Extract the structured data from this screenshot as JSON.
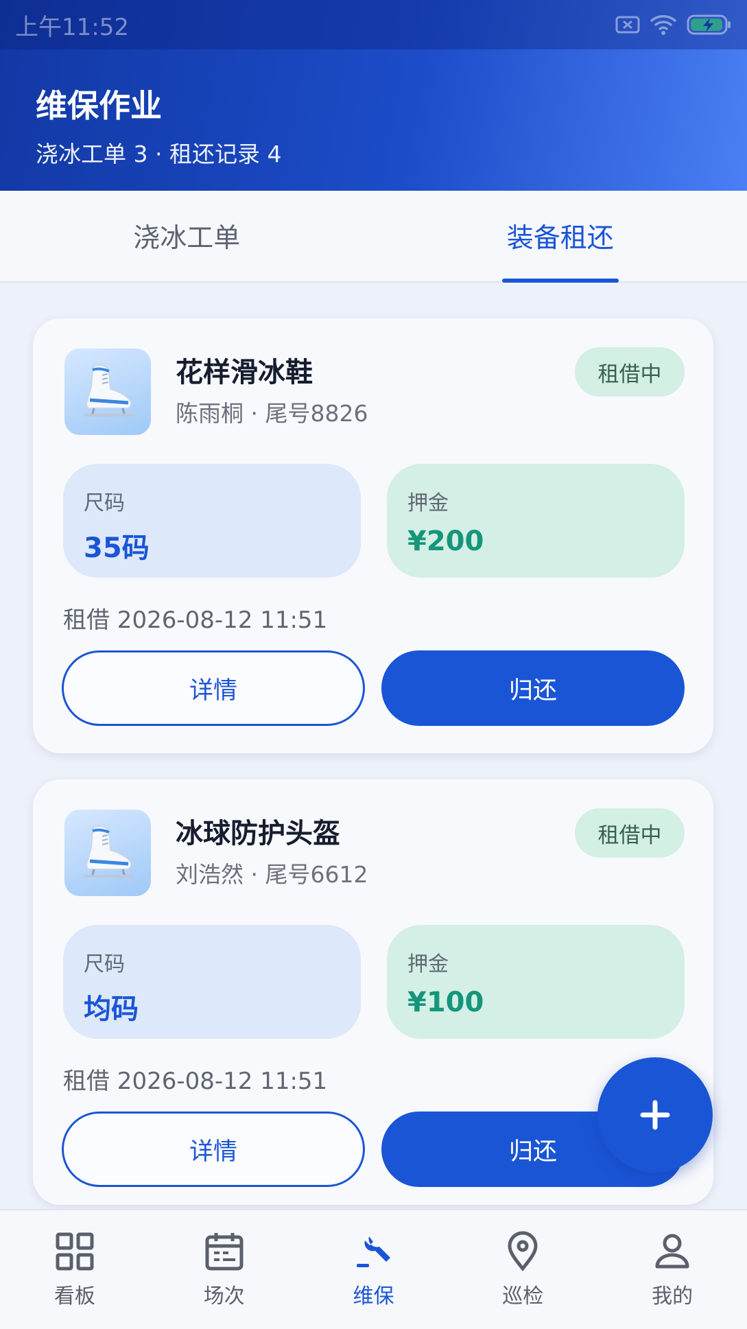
{
  "status_bar": {
    "time": "上午11:52"
  },
  "header": {
    "title": "维保作业",
    "subtitle": "浇冰工单 3 · 租还记录 4"
  },
  "tabs": [
    {
      "label": "浇冰工单",
      "active": false
    },
    {
      "label": "装备租还",
      "active": true
    }
  ],
  "rentals": [
    {
      "icon": "ice-skate-icon",
      "name": "花样滑冰鞋",
      "renter": "陈雨桐 · 尾号8826",
      "status": "租借中",
      "size_label": "尺码",
      "size_value": "35码",
      "deposit_label": "押金",
      "deposit_value": "¥200",
      "rent_time": "租借 2026-08-12 11:51",
      "detail_label": "详情",
      "return_label": "归还"
    },
    {
      "icon": "ice-skate-icon",
      "name": "冰球防护头盔",
      "renter": "刘浩然 · 尾号6612",
      "status": "租借中",
      "size_label": "尺码",
      "size_value": "均码",
      "deposit_label": "押金",
      "deposit_value": "¥100",
      "rent_time": "租借 2026-08-12 11:51",
      "detail_label": "详情",
      "return_label": "归还"
    }
  ],
  "fab": {
    "icon": "plus-icon"
  },
  "bottom_nav": [
    {
      "label": "看板",
      "icon": "grid-icon",
      "active": false
    },
    {
      "label": "场次",
      "icon": "calendar-icon",
      "active": false
    },
    {
      "label": "维保",
      "icon": "wrench-icon",
      "active": true
    },
    {
      "label": "巡检",
      "icon": "location-pin-icon",
      "active": false
    },
    {
      "label": "我的",
      "icon": "user-icon",
      "active": false
    }
  ],
  "colors": {
    "primary": "#1a55d6",
    "header_gradient_start": "#1238a4",
    "header_gradient_end": "#4a7ff5",
    "badge_bg": "#d4efe3",
    "deposit_text": "#15967a"
  }
}
